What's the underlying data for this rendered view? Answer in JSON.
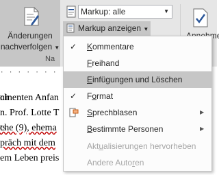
{
  "ribbon": {
    "track_changes_line1": "Änderungen",
    "track_changes_line2": "nachverfolgen",
    "group_label": "Na",
    "markup_select_value": "Markup: alle",
    "markup_anzeigen_label": "Markup anzeigen",
    "annehmen_label": "Annehme"
  },
  "menu": {
    "items": [
      {
        "label_u": "K",
        "label_rest": "ommentare",
        "checked": true
      },
      {
        "label_u": "F",
        "label_rest": "reihand",
        "checked": false
      },
      {
        "label_u": "E",
        "label_rest": "infügungen und Löschen",
        "checked": false,
        "highlighted": true
      },
      {
        "label_u": "",
        "label_pre": "F",
        "label_u2": "o",
        "label_rest": "rmat",
        "checked": true
      },
      {
        "label_u": "S",
        "label_rest": "prechblasen",
        "submenu": true
      },
      {
        "label_u": "B",
        "label_rest": "estimmte Personen",
        "submenu": true
      },
      {
        "label_pre": "Akt",
        "label_u2": "u",
        "label_rest": "alisierungen hervorheben",
        "disabled": true
      },
      {
        "label_pre": "Andere Auto",
        "label_u2": "r",
        "label_rest": "en",
        "disabled": true
      }
    ],
    "checkmark": "✓",
    "submenu_arrow": "▶"
  },
  "document": {
    "line1_left": "ninenten Anfan",
    "line1_right": "ch",
    "line2_left": "n. Prof. Lotte T",
    "line3_left": "che (9), ehema",
    "line3_right": "ts",
    "line4_left": "präch mit dem",
    "line5_left": "em Leben preis"
  },
  "colors": {
    "ribbon_bg": "#e6e6e6",
    "active_bg": "#c6c6c6",
    "accent_blue": "#2b579a"
  }
}
